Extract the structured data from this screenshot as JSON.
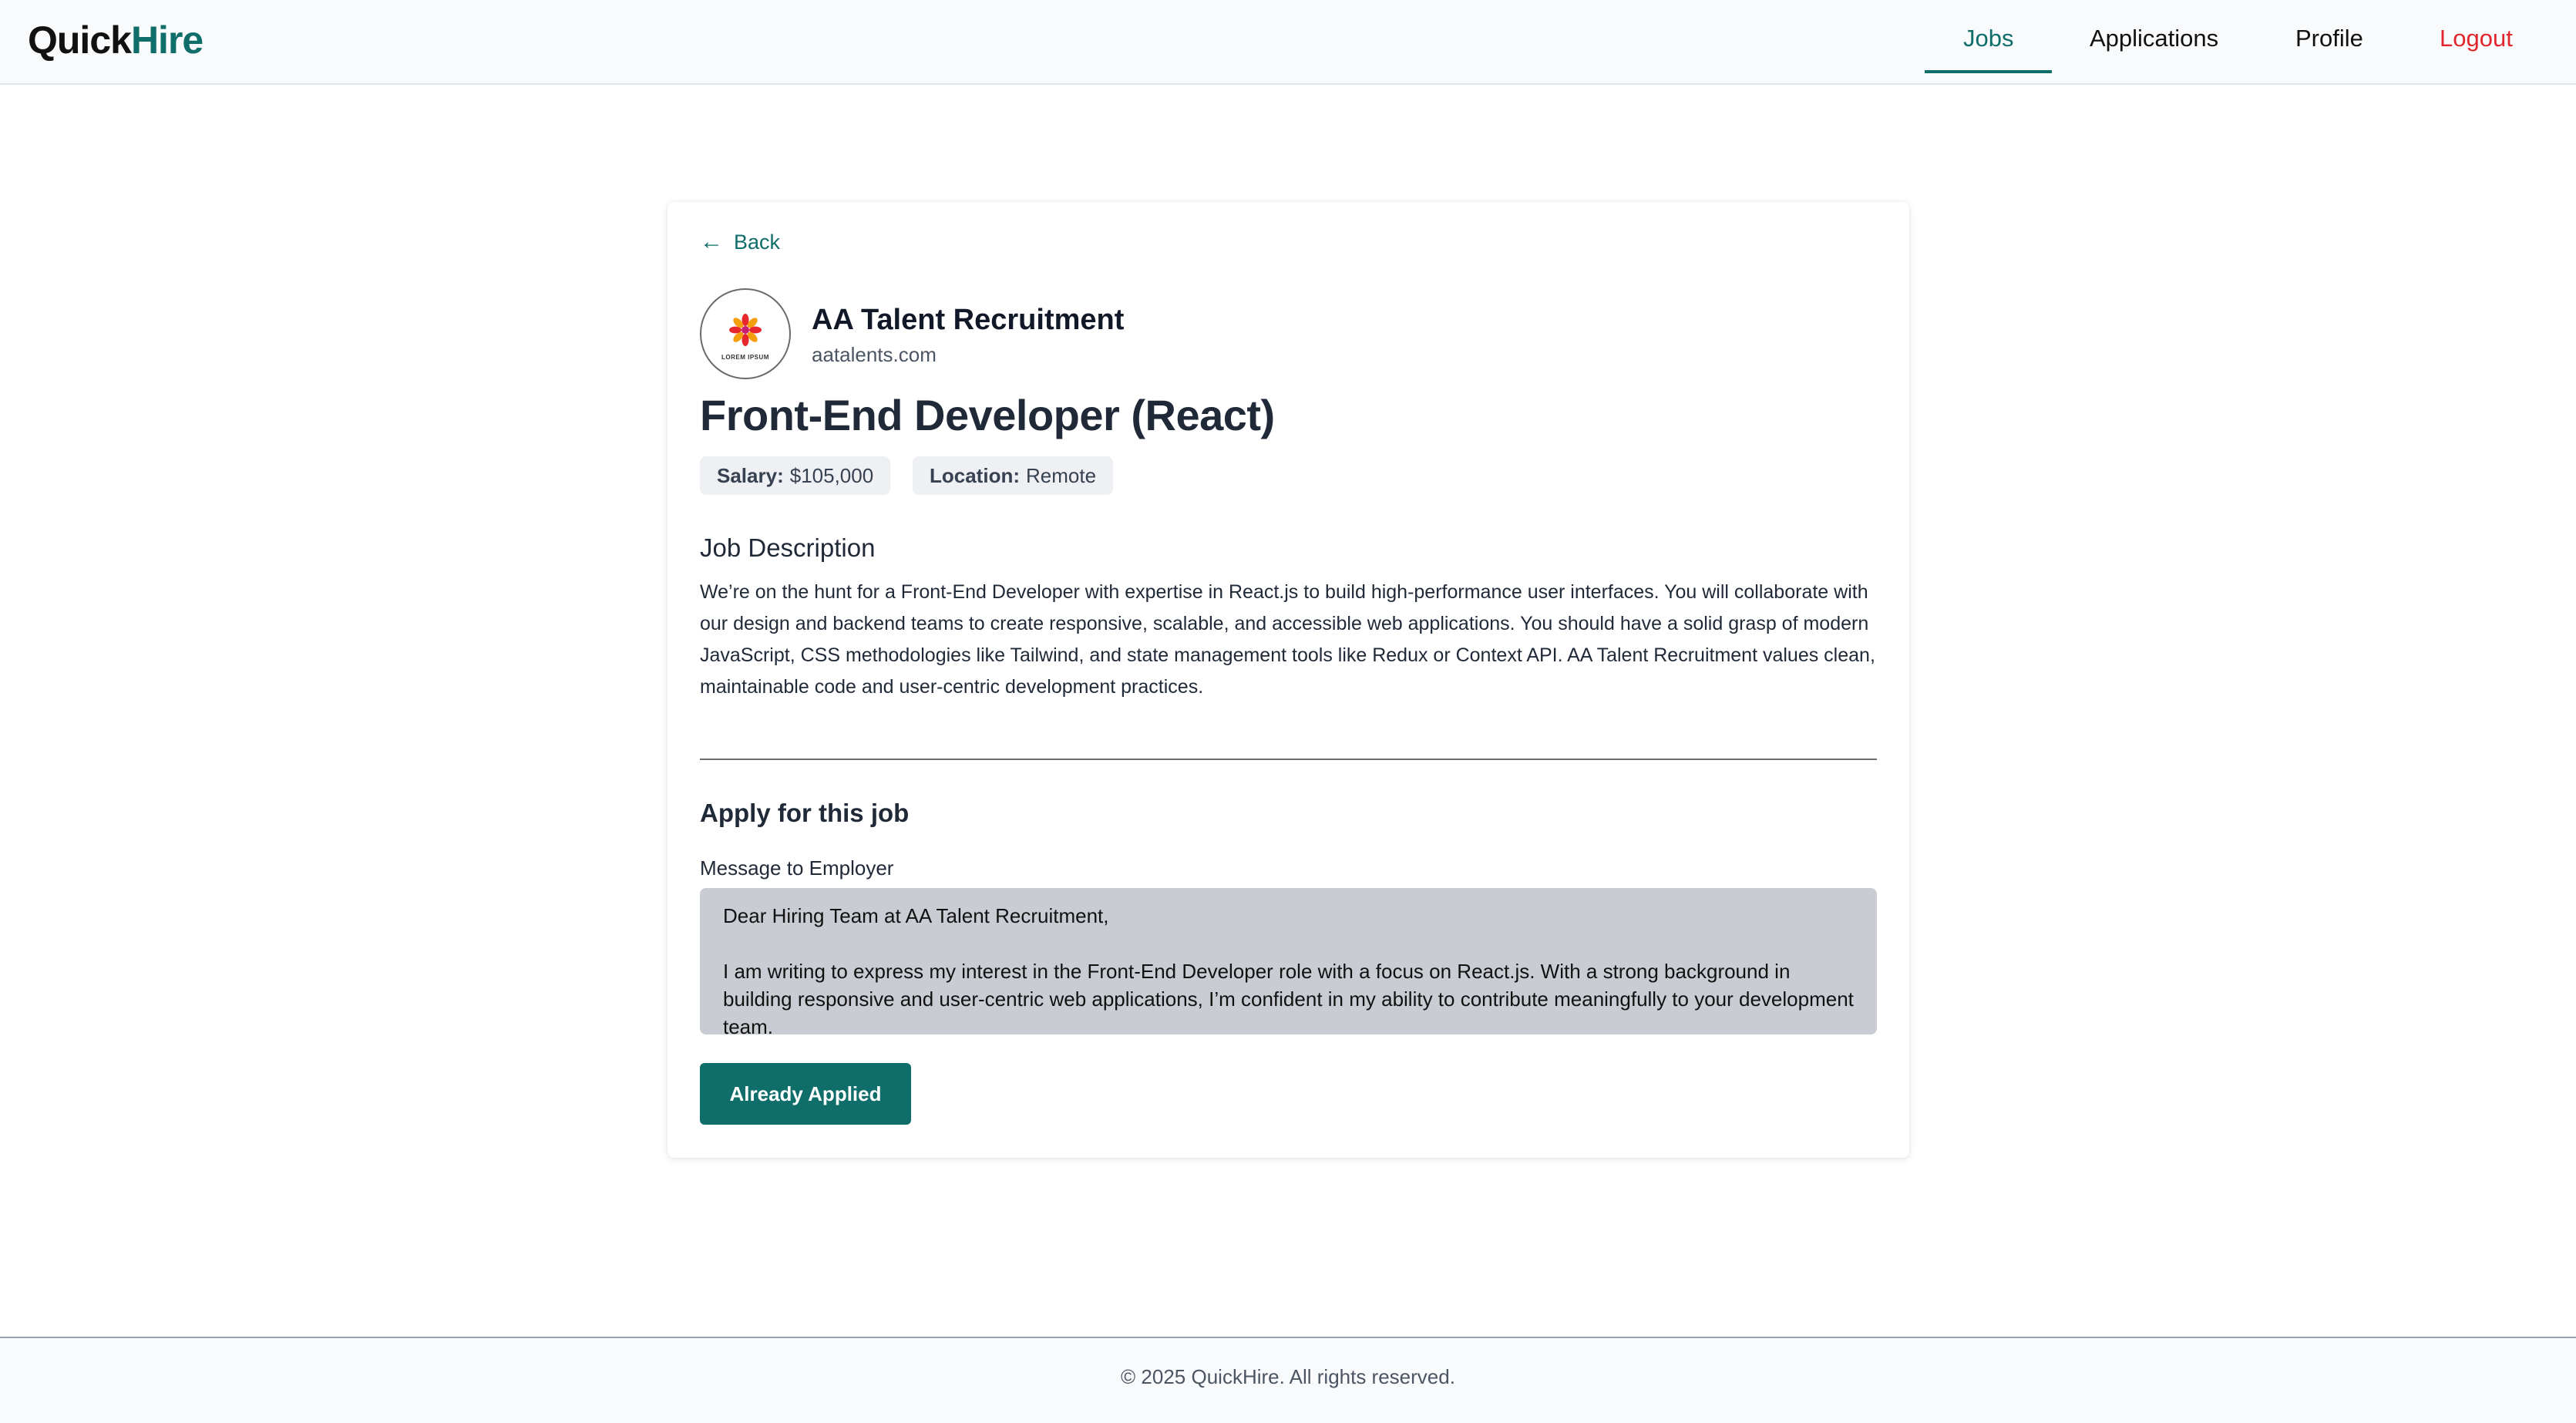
{
  "brand": {
    "part1": "Quick",
    "part2": "Hire"
  },
  "nav": {
    "jobs": "Jobs",
    "applications": "Applications",
    "profile": "Profile",
    "logout": "Logout"
  },
  "back_label": "Back",
  "company": {
    "name": "AA Talent Recruitment",
    "domain": "aatalents.com",
    "logo_caption": "LOREM IPSUM"
  },
  "job": {
    "title": "Front-End Developer (React)",
    "salary_label": "Salary:",
    "salary_value": "$105,000",
    "location_label": "Location:",
    "location_value": "Remote",
    "description_heading": "Job Description",
    "description": "We’re on the hunt for a Front-End Developer with expertise in React.js to build high-performance user interfaces. You will collaborate with our design and backend teams to create responsive, scalable, and accessible web applications. You should have a solid grasp of modern JavaScript, CSS methodologies like Tailwind, and state management tools like Redux or Context API. AA Talent Recruitment values clean, maintainable code and user-centric development practices."
  },
  "apply": {
    "heading": "Apply for this job",
    "message_label": "Message to Employer",
    "message_value": "Dear Hiring Team at AA Talent Recruitment,\n\nI am writing to express my interest in the Front-End Developer role with a focus on React.js. With a strong background in building responsive and user-centric web applications, I’m confident in my ability to contribute meaningfully to your development team.",
    "button_label": "Already Applied"
  },
  "footer": {
    "text": "© 2025 QuickHire. All rights reserved."
  },
  "colors": {
    "brand": "#0f6e6a",
    "logout": "#e0252d",
    "pill_bg": "#eef0f3",
    "message_bg": "#c9ccd3"
  }
}
